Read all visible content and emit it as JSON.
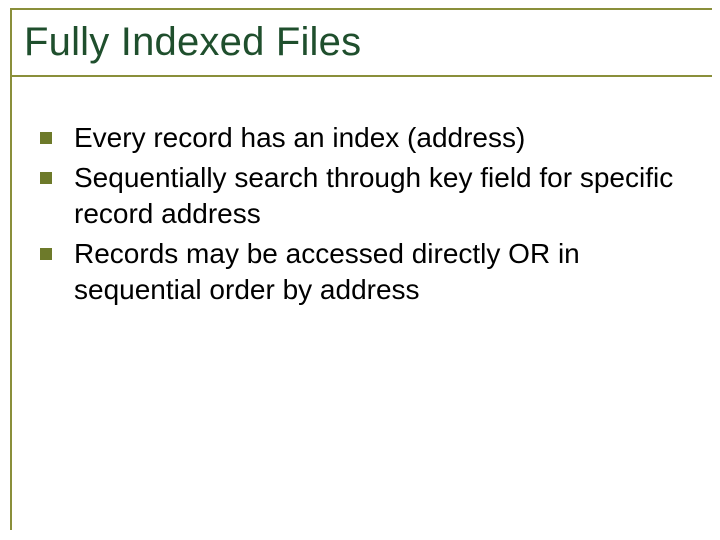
{
  "slide": {
    "title": "Fully Indexed Files",
    "bullets": [
      "Every record has an index (address)",
      "Sequentially search through key field for specific record address",
      "Records may be accessed directly OR in sequential order by address"
    ]
  }
}
